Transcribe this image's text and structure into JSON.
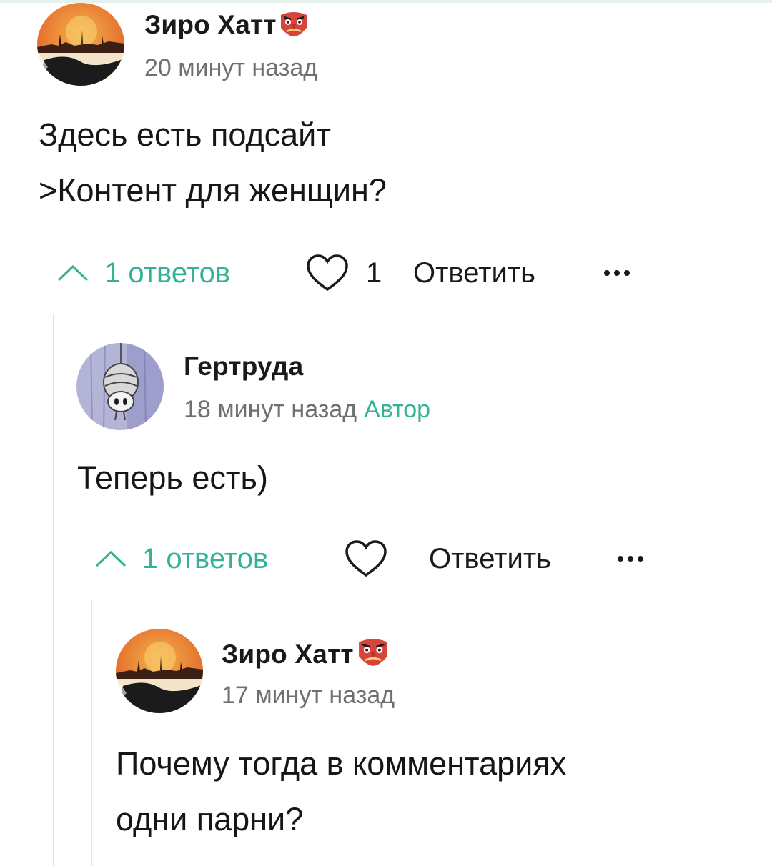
{
  "comments": [
    {
      "author": "Зиро Хатт",
      "author_emoji": "tengu-mask-icon",
      "time": "20 минут назад",
      "text_lines": [
        "Здесь есть подсайт",
        ">Контент для женщин?"
      ],
      "replies_label": "1 ответов",
      "likes": "1",
      "reply_label": "Ответить"
    },
    {
      "author": "Гертруда",
      "time": "18 минут назад",
      "author_tag": "Автор",
      "text_lines": [
        "Теперь есть)"
      ],
      "replies_label": "1 ответов",
      "reply_label": "Ответить"
    },
    {
      "author": "Зиро Хатт",
      "author_emoji": "tengu-mask-icon",
      "time": "17 минут назад",
      "text_lines": [
        "Почему тогда в комментариях",
        "одни парни?"
      ]
    }
  ],
  "colors": {
    "accent": "#35b296",
    "meta_text": "#6f6f6f",
    "thread_line": "#e3e3e3"
  }
}
